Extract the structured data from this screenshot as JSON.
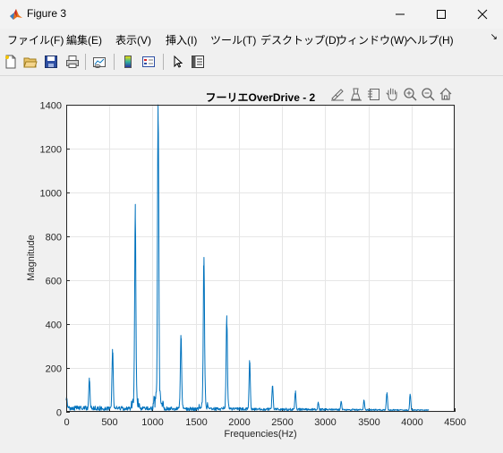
{
  "window": {
    "title": "Figure 3"
  },
  "menubar": {
    "items": [
      "ファイル(F)",
      "編集(E)",
      "表示(V)",
      "挿入(I)",
      "ツール(T)",
      "デスクトップ(D)",
      "ウィンドウ(W)",
      "ヘルプ(H)"
    ]
  },
  "toolbar": {
    "icons": [
      "new-figure-icon",
      "open-file-icon",
      "save-icon",
      "print-icon",
      "link-plot-icon",
      "colorbar-icon",
      "legend-icon",
      "select-pointer-icon",
      "property-inspector-icon"
    ]
  },
  "axes_toolbar": {
    "icons": [
      "brush-icon",
      "data-tips-icon",
      "rotate-icon",
      "pan-icon",
      "zoom-in-icon",
      "zoom-out-icon",
      "home-icon"
    ]
  },
  "colors": {
    "line": "#0072bd",
    "grid": "#e6e6e6",
    "axis": "#262626"
  },
  "chart_data": {
    "type": "line",
    "title": "フーリエOverDrive - 2",
    "xlabel": "Frequencies(Hz)",
    "ylabel": "Magnitude",
    "xlim": [
      0,
      4500
    ],
    "ylim": [
      0,
      1400
    ],
    "xticks": [
      0,
      500,
      1000,
      1500,
      2000,
      2500,
      3000,
      3500,
      4000,
      4500
    ],
    "yticks": [
      0,
      200,
      400,
      600,
      800,
      1000,
      1200,
      1400
    ],
    "grid": true,
    "x_end": 4200,
    "peaks": [
      {
        "x": 5,
        "y": 60
      },
      {
        "x": 268,
        "y": 145
      },
      {
        "x": 537,
        "y": 260
      },
      {
        "x": 800,
        "y": 885
      },
      {
        "x": 1065,
        "y": 1330
      },
      {
        "x": 1330,
        "y": 330
      },
      {
        "x": 1595,
        "y": 660
      },
      {
        "x": 1860,
        "y": 400
      },
      {
        "x": 2125,
        "y": 220
      },
      {
        "x": 2390,
        "y": 110
      },
      {
        "x": 2655,
        "y": 85
      },
      {
        "x": 2920,
        "y": 40
      },
      {
        "x": 3185,
        "y": 45
      },
      {
        "x": 3450,
        "y": 50
      },
      {
        "x": 3715,
        "y": 80
      },
      {
        "x": 3985,
        "y": 75
      }
    ]
  }
}
